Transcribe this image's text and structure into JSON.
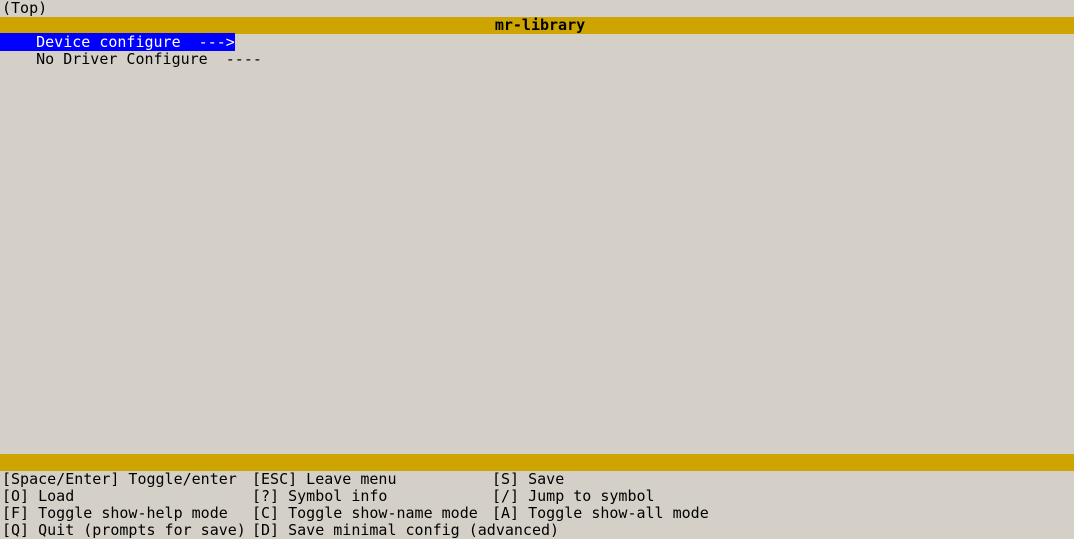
{
  "topbar": {
    "location": "(Top)"
  },
  "title": "mr-library",
  "menu": {
    "items": [
      {
        "label": "    Device configure  --->",
        "selected": true
      },
      {
        "label": "    No Driver Configure  ----",
        "selected": false
      }
    ]
  },
  "help": {
    "rows": [
      {
        "c1": "[Space/Enter] Toggle/enter",
        "c2": "[ESC] Leave menu",
        "c3": "[S] Save"
      },
      {
        "c1": "[O] Load",
        "c2": "[?] Symbol info",
        "c3": "[/] Jump to symbol"
      },
      {
        "c1": "[F] Toggle show-help mode",
        "c2": "[C] Toggle show-name mode",
        "c3": "[A] Toggle show-all mode"
      },
      {
        "c1": "[Q] Quit (prompts for save)",
        "c2": "[D] Save minimal config (advanced)",
        "c3": ""
      }
    ]
  }
}
